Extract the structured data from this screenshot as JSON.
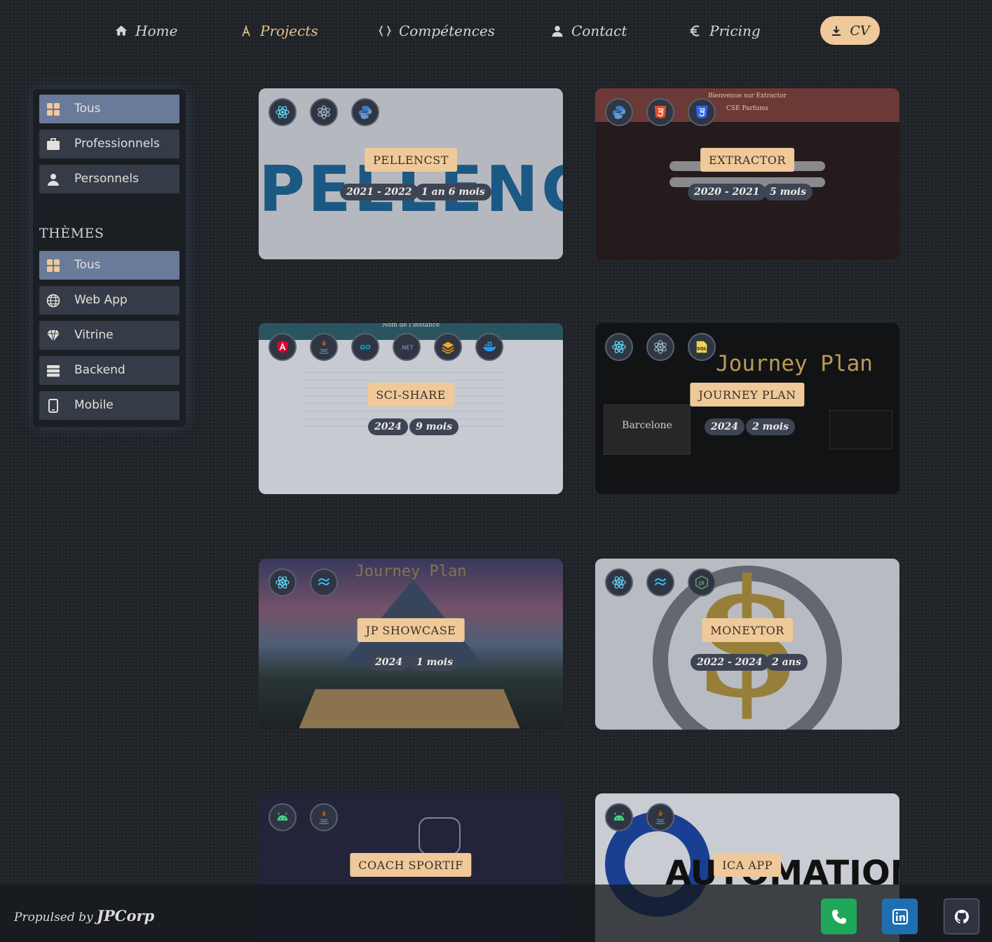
{
  "nav": {
    "items": [
      {
        "label": "Home",
        "icon": "home-icon"
      },
      {
        "label": "Projects",
        "icon": "compass-icon",
        "active": true
      },
      {
        "label": "Compétences",
        "icon": "braces-icon"
      },
      {
        "label": "Contact",
        "icon": "user-icon"
      },
      {
        "label": "Pricing",
        "icon": "euro-icon"
      }
    ],
    "cv_label": "CV"
  },
  "sidebar": {
    "categories": [
      {
        "label": "Tous",
        "icon": "grid-icon",
        "active": true
      },
      {
        "label": "Professionnels",
        "icon": "briefcase-icon"
      },
      {
        "label": "Personnels",
        "icon": "user-icon"
      }
    ],
    "themes_heading": "THÈMES",
    "themes": [
      {
        "label": "Tous",
        "icon": "grid-icon",
        "active": true
      },
      {
        "label": "Web App",
        "icon": "globe-icon"
      },
      {
        "label": "Vitrine",
        "icon": "gem-icon"
      },
      {
        "label": "Backend",
        "icon": "server-icon"
      },
      {
        "label": "Mobile",
        "icon": "mobile-icon"
      }
    ]
  },
  "projects": [
    {
      "title": "PELLENCST",
      "period": "2021 - 2022",
      "duration": "1 an 6 mois",
      "techs": [
        "react-icon",
        "electron-icon",
        "python-icon"
      ],
      "bg_text": "PELLENC"
    },
    {
      "title": "EXTRACTOR",
      "period": "2020 - 2021",
      "duration": "5 mois",
      "techs": [
        "python-icon",
        "html5-icon",
        "css3-icon"
      ],
      "bg_text": "Bienvenue sur Extractor",
      "bg_sub": "CSE Parfums"
    },
    {
      "title": "SCI-SHARE",
      "period": "2024",
      "duration": "9 mois",
      "techs": [
        "angular-icon",
        "java-icon",
        "go-icon",
        "dotnet-icon",
        "layers-icon",
        "docker-icon"
      ],
      "bg_text": "Nom de l'instance"
    },
    {
      "title": "JOURNEY PLAN",
      "period": "2024",
      "duration": "2 mois",
      "techs": [
        "react-icon",
        "electron-icon",
        "sql-icon"
      ],
      "bg_text": "Journey Plan",
      "bg_sub": "Barcelone"
    },
    {
      "title": "JP SHOWCASE",
      "period": "2024",
      "duration": "1 mois",
      "techs": [
        "react-icon",
        "tailwind-icon"
      ],
      "bg_text": "Journey Plan"
    },
    {
      "title": "MONEYTOR",
      "period": "2022 - 2024",
      "duration": "2 ans",
      "techs": [
        "react-icon",
        "tailwind-icon",
        "nodejs-icon"
      ],
      "bg_text": "$"
    },
    {
      "title": "COACH SPORTIF",
      "period": "",
      "duration": "",
      "techs": [
        "android-icon",
        "java-icon"
      ],
      "bg_text": ""
    },
    {
      "title": "ICA APP",
      "period": "",
      "duration": "",
      "techs": [
        "android-icon",
        "java-icon"
      ],
      "bg_text": "AUTOMATION"
    }
  ],
  "footer": {
    "propulsed": "Propulsed by",
    "brand": "JPCorp",
    "buttons": [
      {
        "icon": "phone-icon",
        "color": "#1fa85a"
      },
      {
        "icon": "linkedin-icon",
        "color": "#1f6fb0"
      },
      {
        "icon": "github-icon",
        "color": "#2f3340"
      }
    ]
  },
  "colors": {
    "accent": "#efc99a",
    "active_side": "#6a7a99",
    "side_item": "#353c48",
    "pill": "#3d4454"
  }
}
